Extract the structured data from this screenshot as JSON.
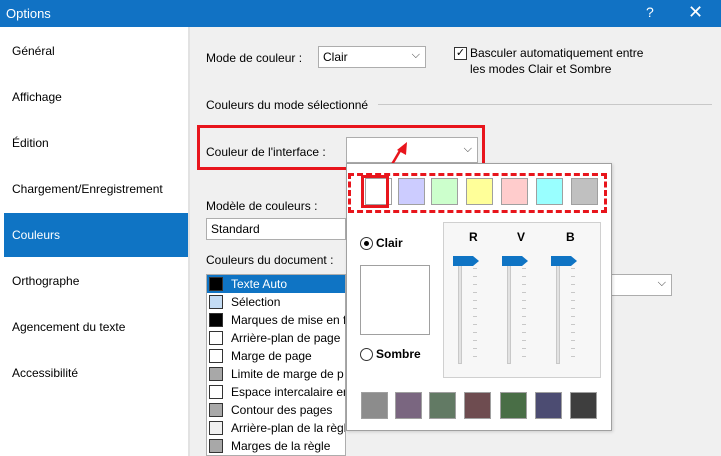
{
  "window": {
    "title": "Options",
    "help_icon": "question-icon",
    "close_icon": "close-icon"
  },
  "sidebar": {
    "items": [
      {
        "label": "Général"
      },
      {
        "label": "Affichage"
      },
      {
        "label": "Édition"
      },
      {
        "label": "Chargement/Enregistrement"
      },
      {
        "label": "Couleurs",
        "selected": true
      },
      {
        "label": "Orthographe"
      },
      {
        "label": "Agencement du texte"
      },
      {
        "label": "Accessibilité"
      }
    ]
  },
  "main": {
    "color_mode_label": "Mode de couleur :",
    "color_mode_value": "Clair",
    "auto_switch_checked": true,
    "auto_switch_label_1": "Basculer automatiquement entre",
    "auto_switch_label_2": "les modes Clair et Sombre",
    "section_title": "Couleurs du mode sélectionné",
    "interface_color_label": "Couleur de l'interface :",
    "color_model_label": "Modèle de couleurs :",
    "color_model_value": "Standard",
    "document_colors_label": "Couleurs du document :",
    "document_colors": [
      {
        "label": "Texte Auto",
        "color": "#000000",
        "selected": true
      },
      {
        "label": "Sélection",
        "color": "#c4dcf4"
      },
      {
        "label": "Marques de mise en f",
        "color": "#000000"
      },
      {
        "label": "Arrière-plan de page",
        "color": "#ffffff"
      },
      {
        "label": "Marge de page",
        "color": "#ffffff"
      },
      {
        "label": "Limite de marge de p",
        "color": "#a8a8a8"
      },
      {
        "label": "Espace intercalaire en",
        "color": "#ffffff"
      },
      {
        "label": "Contour des pages",
        "color": "#a8a8a8"
      },
      {
        "label": "Arrière-plan de la règle",
        "color": "#f0f0f0"
      },
      {
        "label": "Marges de la règle",
        "color": "#a8a8a8"
      }
    ]
  },
  "picker": {
    "top_swatches": [
      "#ffffff",
      "#ccccff",
      "#ccffcc",
      "#ffff99",
      "#ffcccc",
      "#99ffff",
      "#c0c0c0"
    ],
    "light_label": "Clair",
    "dark_label": "Sombre",
    "light_selected": true,
    "slider_r": "R",
    "slider_v": "V",
    "slider_b": "B",
    "slider_r_level": 1.0,
    "slider_v_level": 1.0,
    "slider_b_level": 1.0,
    "bottom_swatches": [
      "#8c8c8c",
      "#7a6680",
      "#627a64",
      "#6e4c50",
      "#496e46",
      "#4c4c72",
      "#3e3e3e"
    ]
  }
}
